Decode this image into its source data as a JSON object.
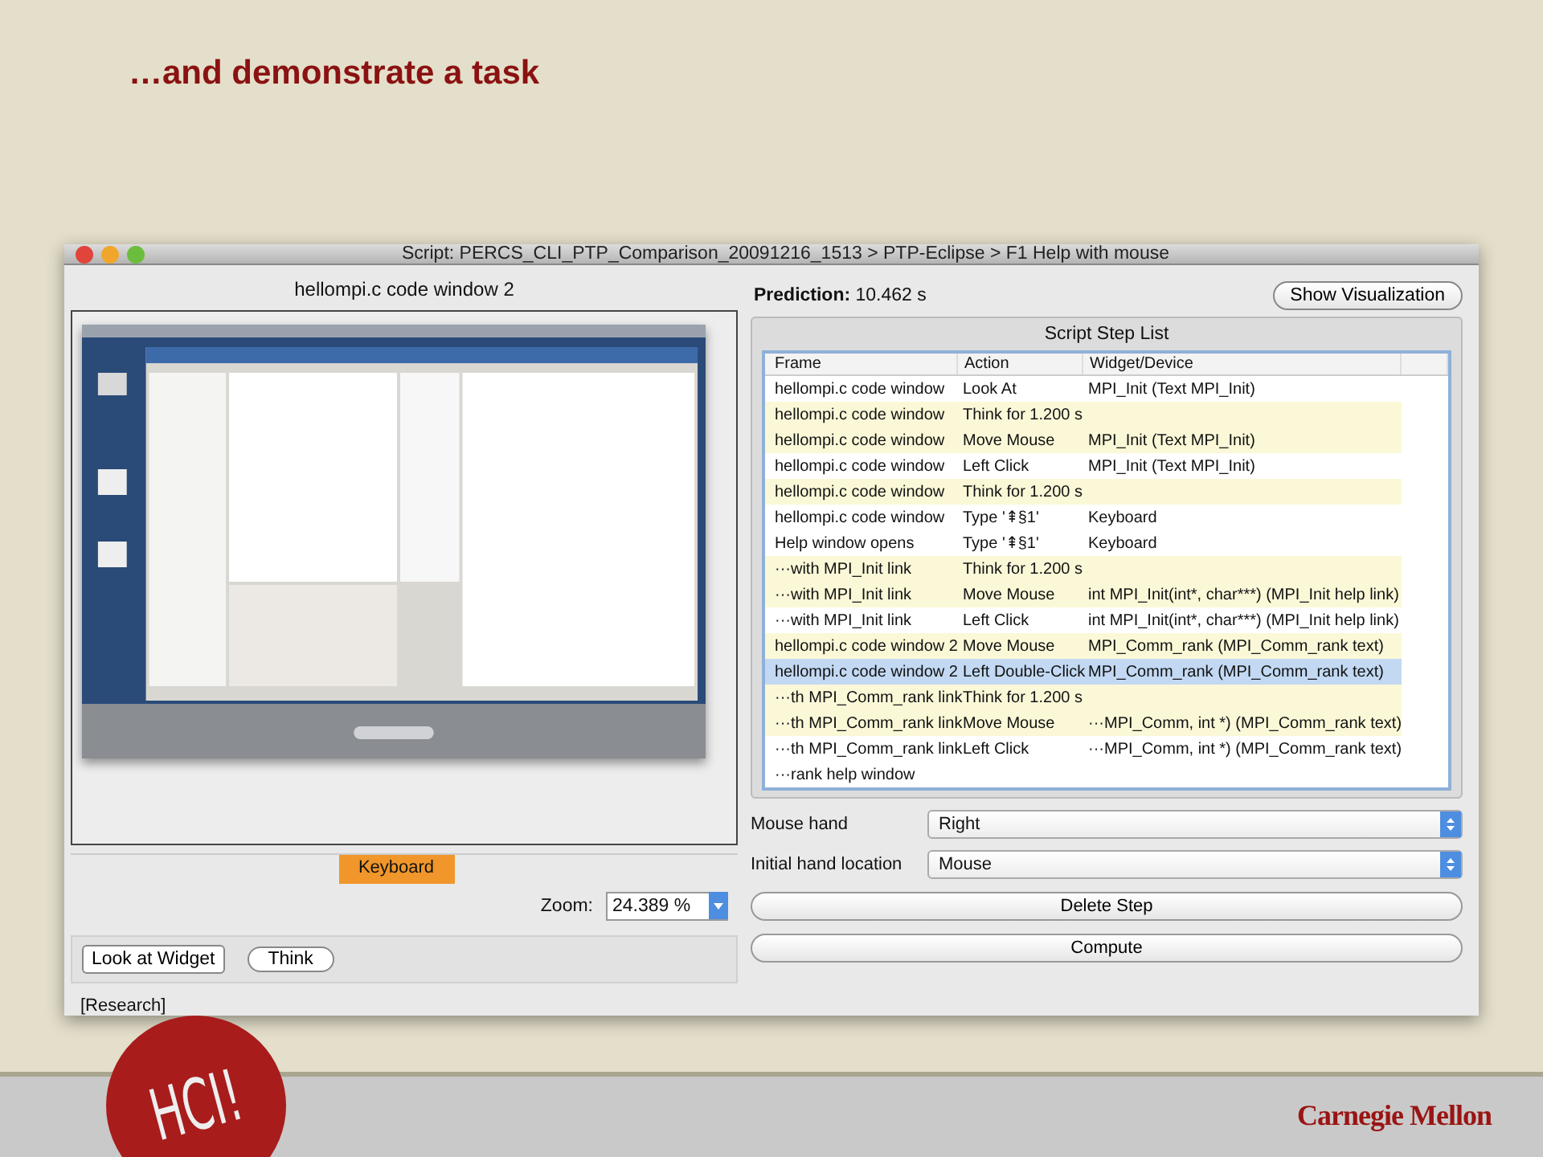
{
  "slide": {
    "title": "…and demonstrate a task",
    "footer_logo": "HCI!",
    "footer_brand": "Carnegie Mellon"
  },
  "window": {
    "title": "Script: PERCS_CLI_PTP_Comparison_20091216_1513 > PTP-Eclipse > F1 Help with mouse"
  },
  "frame_view": {
    "title": "hellompi.c code window 2",
    "tab": "Keyboard",
    "zoom_label": "Zoom:",
    "zoom_value": "24.389 %"
  },
  "tools": [
    "Look at Widget",
    "Think"
  ],
  "status": "[Research]",
  "prediction": {
    "label": "Prediction:",
    "value": "10.462 s"
  },
  "show_visualization": "Show Visualization",
  "step_list": {
    "title": "Script Step List",
    "columns": [
      "Frame",
      "Action",
      "Widget/Device"
    ],
    "rows": [
      {
        "cells": [
          "hellompi.c code window",
          "Look At",
          "MPI_Init (Text MPI_Init)"
        ],
        "highlighted": false,
        "selected": false
      },
      {
        "cells": [
          "hellompi.c code window",
          "Think for 1.200 s",
          ""
        ],
        "highlighted": true,
        "selected": false
      },
      {
        "cells": [
          "hellompi.c code window",
          "Move Mouse",
          "MPI_Init (Text MPI_Init)"
        ],
        "highlighted": true,
        "selected": false
      },
      {
        "cells": [
          "hellompi.c code window",
          "Left Click",
          "MPI_Init (Text MPI_Init)"
        ],
        "highlighted": false,
        "selected": false
      },
      {
        "cells": [
          "hellompi.c code window",
          "Think for 1.200 s",
          ""
        ],
        "highlighted": true,
        "selected": false
      },
      {
        "cells": [
          "hellompi.c code window",
          "Type '⇞§1'",
          "Keyboard"
        ],
        "highlighted": false,
        "selected": false
      },
      {
        "cells": [
          "Help window opens",
          "Type '⇞§1'",
          "Keyboard"
        ],
        "highlighted": false,
        "selected": false
      },
      {
        "cells": [
          "···with MPI_Init link",
          "Think for 1.200 s",
          ""
        ],
        "highlighted": true,
        "selected": false
      },
      {
        "cells": [
          "···with MPI_Init link",
          "Move Mouse",
          "int MPI_Init(int*, char***) (MPI_Init help link)"
        ],
        "highlighted": true,
        "selected": false
      },
      {
        "cells": [
          "···with MPI_Init link",
          "Left Click",
          "int MPI_Init(int*, char***) (MPI_Init help link)"
        ],
        "highlighted": false,
        "selected": false
      },
      {
        "cells": [
          "hellompi.c code window 2",
          "Move Mouse",
          "MPI_Comm_rank (MPI_Comm_rank text)"
        ],
        "highlighted": true,
        "selected": false
      },
      {
        "cells": [
          "hellompi.c code window 2",
          "Left Double-Click",
          "MPI_Comm_rank (MPI_Comm_rank text)"
        ],
        "highlighted": false,
        "selected": true
      },
      {
        "cells": [
          "···th MPI_Comm_rank link",
          "Think for 1.200 s",
          ""
        ],
        "highlighted": true,
        "selected": false
      },
      {
        "cells": [
          "···th MPI_Comm_rank link",
          "Move Mouse",
          "···MPI_Comm, int *) (MPI_Comm_rank text)"
        ],
        "highlighted": true,
        "selected": false
      },
      {
        "cells": [
          "···th MPI_Comm_rank link",
          "Left Click",
          "···MPI_Comm, int *) (MPI_Comm_rank text)"
        ],
        "highlighted": false,
        "selected": false
      },
      {
        "cells": [
          "···rank help window",
          "",
          ""
        ],
        "highlighted": false,
        "selected": false
      }
    ]
  },
  "settings": [
    {
      "label": "Mouse hand",
      "value": "Right"
    },
    {
      "label": "Initial hand location",
      "value": "Mouse"
    }
  ],
  "actions": [
    "Delete Step",
    "Compute"
  ]
}
